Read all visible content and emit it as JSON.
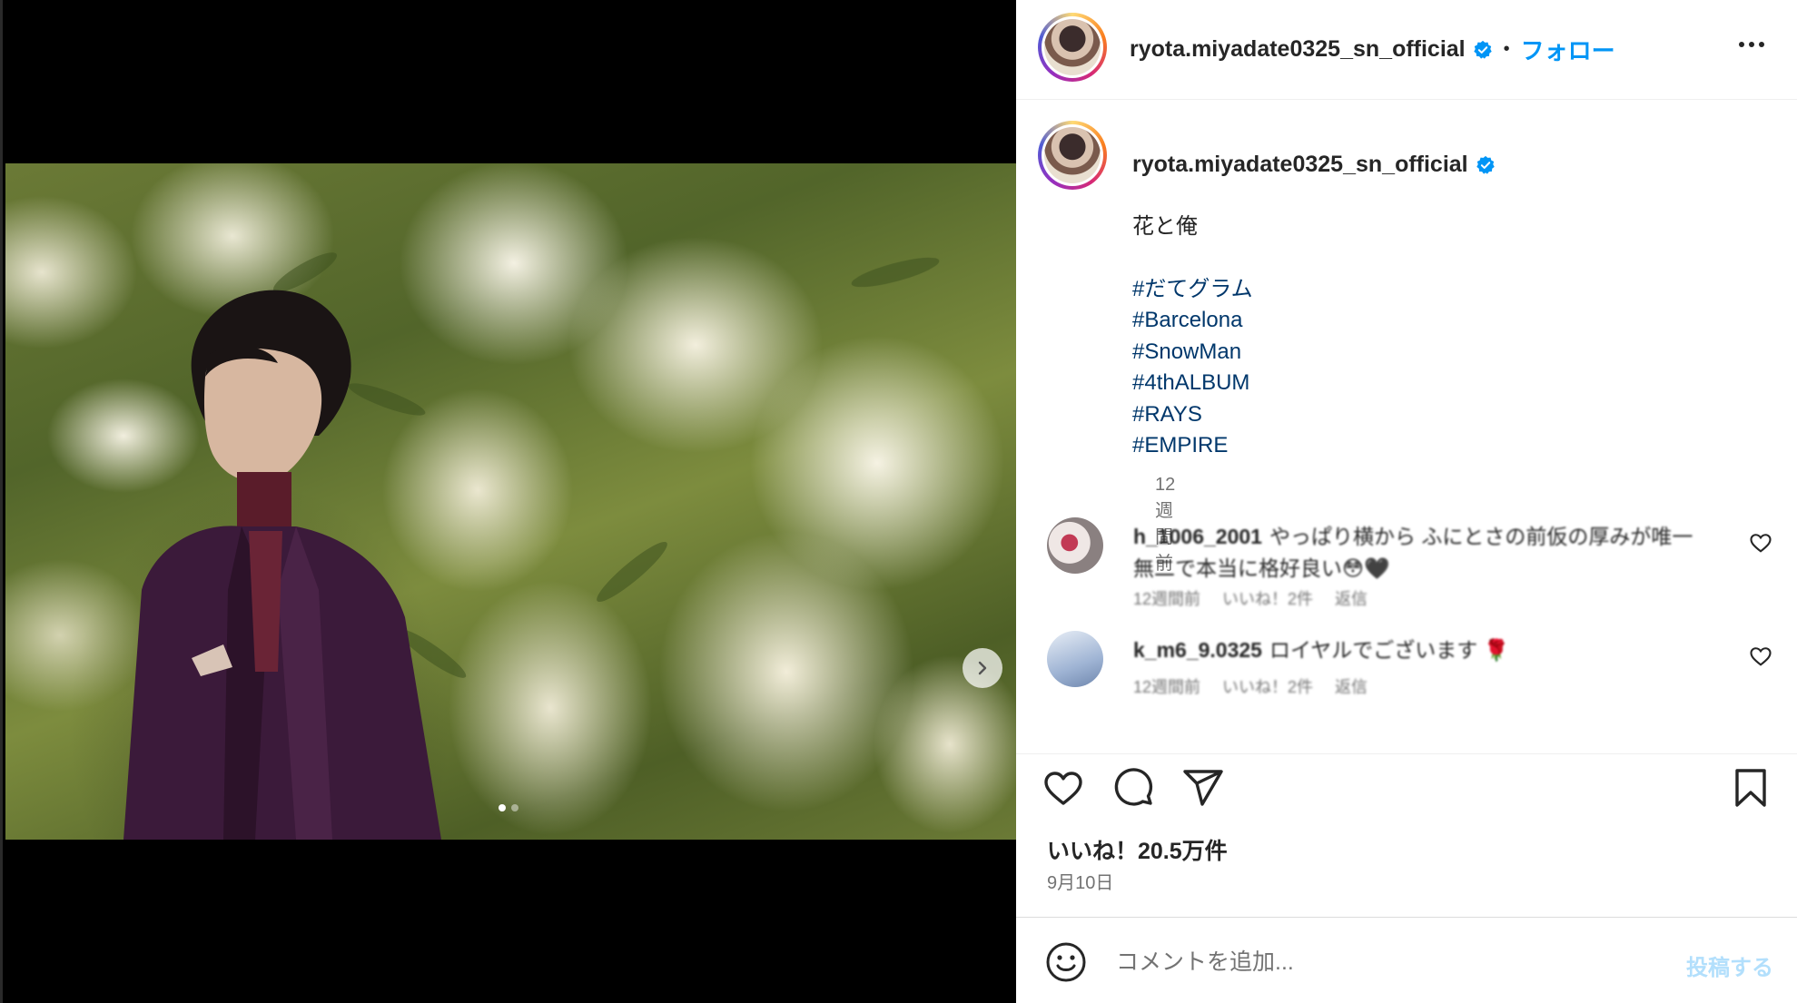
{
  "post": {
    "username": "ryota.miyadate0325_sn_official",
    "separator": "•",
    "follow_label": "フォロー",
    "more_icon": "more-horizontal-icon"
  },
  "caption": {
    "username": "ryota.miyadate0325_sn_official",
    "text": "花と俺",
    "hashtags": [
      "#だてグラム",
      "#Barcelona",
      "#SnowMan",
      "#4thALBUM",
      "#RAYS",
      "#EMPIRE"
    ],
    "time_ago": "12週間前"
  },
  "comments": [
    {
      "username": "h_1006_2001",
      "text": "やっぱり横から ふにとさの前仮の厚みが唯一無二で本当に格好良い😳🖤",
      "time": "12週間前",
      "likes": "いいね！2件",
      "reply": "返信"
    },
    {
      "username": "k_m6_9.0325",
      "text": "ロイヤルでございます 🌹",
      "time": "12週間前",
      "likes": "いいね！2件",
      "reply": "返信"
    }
  ],
  "stats": {
    "likes_label": "いいね！20.5万件",
    "date": "9月10日"
  },
  "compose": {
    "placeholder": "コメントを追加...",
    "post_label": "投稿する"
  },
  "media": {
    "slide_count": 2,
    "active_slide": 1
  },
  "colors": {
    "accent": "#0095f6",
    "link": "#00376b",
    "muted": "#737373",
    "post_disabled": "#b2dffc"
  }
}
